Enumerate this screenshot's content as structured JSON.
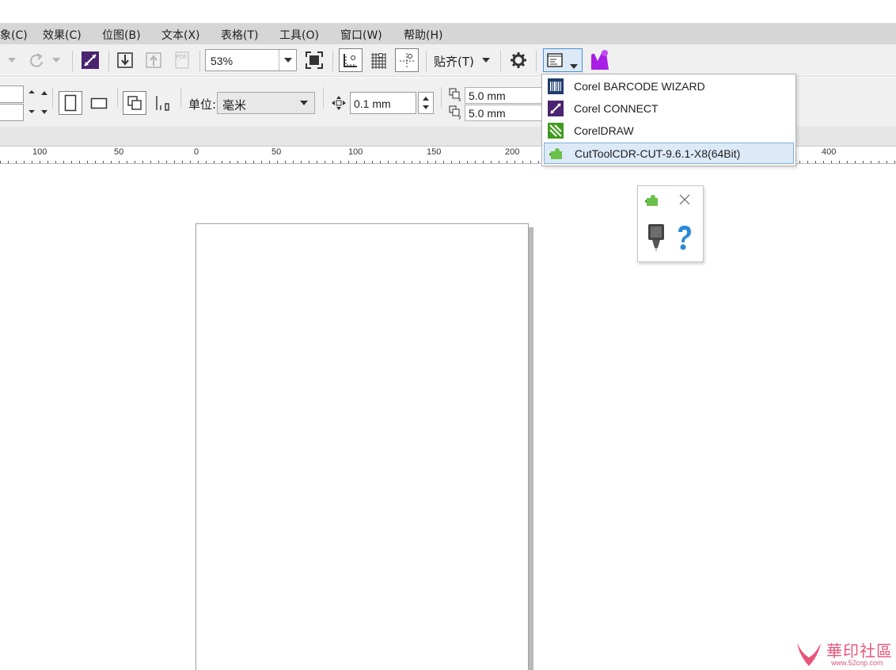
{
  "menu": {
    "items": [
      "象(C)",
      "效果(C)",
      "位图(B)",
      "文本(X)",
      "表格(T)",
      "工具(O)",
      "窗口(W)",
      "帮助(H)"
    ]
  },
  "toolbar": {
    "zoom": "53%",
    "snap_label": "贴齐(T)",
    "icons": [
      "undo-icon",
      "redo-icon",
      "corel-connect-icon",
      "import-icon",
      "export-icon",
      "pdf-icon",
      "full-screen-icon",
      "rulers-icon",
      "grid-icon",
      "guidelines-icon",
      "settings-icon",
      "application-launcher-icon",
      "cuttool-plugin-icon"
    ]
  },
  "propertybar": {
    "unit_label": "单位:",
    "unit_value": "毫米",
    "nudge_value": "0.1 mm",
    "dup_x": "5.0 mm",
    "dup_y": "5.0 mm"
  },
  "ruler": {
    "labels": [
      "100",
      "50",
      "0",
      "50",
      "100",
      "150",
      "200",
      "400"
    ]
  },
  "launcher_menu": {
    "items": [
      {
        "label": "Corel BARCODE WIZARD",
        "icon": "barcode-icon"
      },
      {
        "label": "Corel CONNECT",
        "icon": "corel-connect-icon"
      },
      {
        "label": "CorelDRAW",
        "icon": "coreldraw-icon"
      },
      {
        "label": "CutToolCDR-CUT-9.6.1-X8(64Bit)",
        "icon": "puzzle-plugin-icon",
        "selected": true
      }
    ]
  },
  "floating_toolbar": {
    "icons": [
      "puzzle-plugin-icon",
      "close-icon",
      "cutter-blade-icon",
      "help-icon"
    ]
  },
  "watermark": {
    "text": "華印社區",
    "url": "www.52cnp.com"
  },
  "colors": {
    "menubar": "#d6d6d6",
    "toolbar": "#f0f0f0",
    "selection": "#dceaf7",
    "accent_purple": "#5b2a86",
    "plugin_magenta": "#a81ee6"
  }
}
